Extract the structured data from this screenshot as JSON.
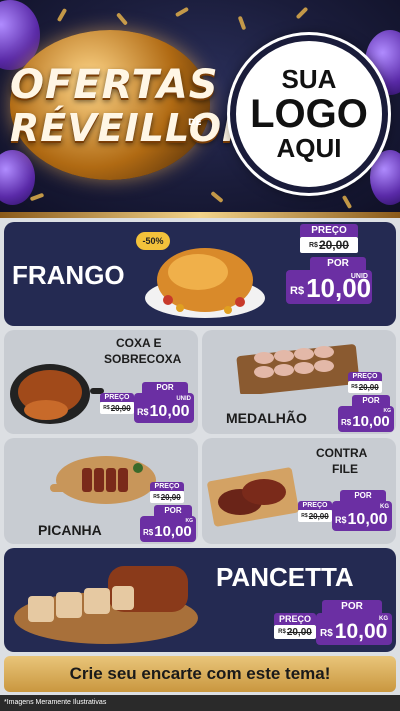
{
  "header": {
    "brand_line1": "OFERTAS",
    "brand_line2": "RÉVEILLON",
    "brand_de": "DE",
    "logo_line1": "SUA",
    "logo_line2": "LOGO",
    "logo_line3": "AQUI"
  },
  "colors": {
    "dark_card": "#242a52",
    "light_card": "#c8ccd2",
    "price_purple": "#6b2fa3",
    "gold": "#d6a64a"
  },
  "badge": "-50%",
  "products": [
    {
      "name": "FRANGO",
      "tag": "PREÇO",
      "old_currency": "R$",
      "old_value": "20,00",
      "new_label": "POR",
      "currency": "R$",
      "value": "10,00",
      "unit": "UNID"
    },
    {
      "name_l1": "COXA E",
      "name_l2": "SOBRECOXA",
      "tag": "PREÇO",
      "old_currency": "R$",
      "old_value": "20,00",
      "new_label": "POR",
      "currency": "R$",
      "value": "10,00",
      "unit": "UNID"
    },
    {
      "name": "MEDALHÃO",
      "tag": "PREÇO",
      "old_currency": "R$",
      "old_value": "20,00",
      "new_label": "POR",
      "currency": "R$",
      "value": "10,00",
      "unit": "KG"
    },
    {
      "name": "PICANHA",
      "tag": "PREÇO",
      "old_currency": "R$",
      "old_value": "20,00",
      "new_label": "POR",
      "currency": "R$",
      "value": "10,00",
      "unit": "KG"
    },
    {
      "name_l1": "CONTRA",
      "name_l2": "FILE",
      "tag": "PREÇO",
      "old_currency": "R$",
      "old_value": "20,00",
      "new_label": "POR",
      "currency": "R$",
      "value": "10,00",
      "unit": "KG"
    },
    {
      "name": "PANCETTA",
      "tag": "PREÇO",
      "old_currency": "R$",
      "old_value": "20,00",
      "new_label": "POR",
      "currency": "R$",
      "value": "10,00",
      "unit": "KG"
    }
  ],
  "cta": "Crie seu encarte com este tema!",
  "disclaimer": "*Imagens Meramente Ilustrativas"
}
